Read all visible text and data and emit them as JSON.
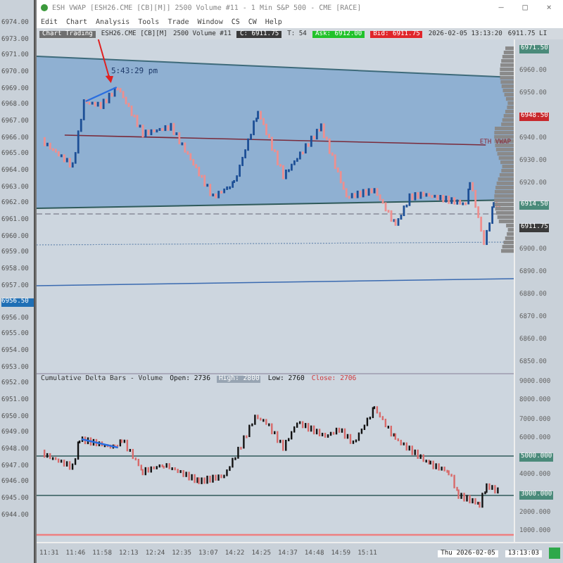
{
  "side_scale": [
    {
      "text": "6974.00",
      "kind": "tick"
    },
    {
      "text": "6973.00",
      "kind": "tick"
    },
    {
      "text": "6971.00",
      "kind": "tick"
    },
    {
      "text": "6970.00",
      "kind": "tick"
    },
    {
      "text": "6969.00",
      "kind": "tick"
    },
    {
      "text": "6968.00",
      "kind": "tick"
    },
    {
      "text": "6967.00",
      "kind": "tick"
    },
    {
      "text": "6966.00",
      "kind": "tick"
    },
    {
      "text": "6965.00",
      "kind": "tick"
    },
    {
      "text": "6964.00",
      "kind": "tick"
    },
    {
      "text": "6963.00",
      "kind": "tick"
    },
    {
      "text": "6962.00",
      "kind": "tick"
    },
    {
      "text": "6961.00",
      "kind": "tick"
    },
    {
      "text": "6960.00",
      "kind": "tick"
    },
    {
      "text": "6959.00",
      "kind": "tick"
    },
    {
      "text": "6958.00",
      "kind": "tick"
    },
    {
      "text": "6957.00",
      "kind": "tick"
    },
    {
      "text": "6956.50",
      "kind": "marker"
    },
    {
      "text": "6956.00",
      "kind": "tick"
    },
    {
      "text": "6955.00",
      "kind": "tick"
    },
    {
      "text": "6954.00",
      "kind": "tick"
    },
    {
      "text": "6953.00",
      "kind": "tick"
    },
    {
      "text": "6952.00",
      "kind": "tick"
    },
    {
      "text": "6951.00",
      "kind": "tick"
    },
    {
      "text": "6950.00",
      "kind": "tick"
    },
    {
      "text": "6949.00",
      "kind": "tick"
    },
    {
      "text": "6948.00",
      "kind": "tick"
    },
    {
      "text": "6947.00",
      "kind": "tick"
    },
    {
      "text": "6946.00",
      "kind": "tick"
    },
    {
      "text": "6945.00",
      "kind": "tick"
    },
    {
      "text": "6944.00",
      "kind": "tick"
    }
  ],
  "window": {
    "title": "ESH VWAP [ESH26.CME [CB][M]] 2500 Volume #11 - 1 Min S&P 500 - CME [RACE]",
    "controls": [
      "–",
      "□",
      "×"
    ]
  },
  "menu": [
    "Edit",
    "Chart",
    "Analysis",
    "Tools",
    "Trade",
    "Window",
    "CS",
    "CW",
    "Help"
  ],
  "info_bar": [
    {
      "text": "Chart Trading",
      "kind": "box",
      "color": "#6f6f6f"
    },
    {
      "text": "ESH26.CME [CB][M]",
      "kind": "plain"
    },
    {
      "text": "2500 Volume #11",
      "kind": "plain"
    },
    {
      "text": "C: 6911.75",
      "kind": "box",
      "color": "#3a3a3a"
    },
    {
      "text": "T: 54",
      "kind": "plain"
    },
    {
      "text": "Ask: 6912.00",
      "kind": "box",
      "color": "#22c22a"
    },
    {
      "text": "Bid: 6911.75",
      "kind": "box",
      "color": "#e0262a"
    },
    {
      "text": "2026-02-05 13:13:20",
      "kind": "plain"
    },
    {
      "text": "6911.75 LI",
      "kind": "plain"
    }
  ],
  "price_pane": {
    "annotation": "5:43:29 pm",
    "vwap_label": "ETH VWAP"
  },
  "price_axis": [
    {
      "text": "6971.50",
      "kind": "tag",
      "color": "#4a8a7a"
    },
    {
      "text": "6960.00",
      "kind": "tick"
    },
    {
      "text": "6950.00",
      "kind": "tick"
    },
    {
      "text": "6948.50",
      "kind": "tag",
      "color": "#c8282c"
    },
    {
      "text": "6940.00",
      "kind": "tick"
    },
    {
      "text": "6930.00",
      "kind": "tick"
    },
    {
      "text": "6920.00",
      "kind": "tick"
    },
    {
      "text": "6914.50",
      "kind": "tag",
      "color": "#4a8a7a"
    },
    {
      "text": "6911.75",
      "kind": "tag",
      "color": "#3a3a3a"
    },
    {
      "text": "6900.00",
      "kind": "tick"
    },
    {
      "text": "6890.00",
      "kind": "tick"
    },
    {
      "text": "6880.00",
      "kind": "tick"
    },
    {
      "text": "6870.00",
      "kind": "tick"
    },
    {
      "text": "6860.00",
      "kind": "tick"
    },
    {
      "text": "6850.00",
      "kind": "tick"
    }
  ],
  "delta_pane": {
    "header": [
      {
        "text": "Cumulative Delta Bars - Volume",
        "kind": "title"
      },
      {
        "text": "Open: 2736",
        "kind": "value"
      },
      {
        "text": "High: 2800",
        "kind": "light"
      },
      {
        "text": "Low: 2760",
        "kind": "value"
      },
      {
        "text": "Close: 2706",
        "kind": "alert"
      }
    ]
  },
  "delta_axis": [
    {
      "text": "9000.000",
      "kind": "tick"
    },
    {
      "text": "8000.000",
      "kind": "tick"
    },
    {
      "text": "7000.000",
      "kind": "tick"
    },
    {
      "text": "6000.000",
      "kind": "tick"
    },
    {
      "text": "5000.000",
      "kind": "tag",
      "color": "#4a8a7a"
    },
    {
      "text": "4000.000",
      "kind": "tick"
    },
    {
      "text": "3000.000",
      "kind": "tag",
      "color": "#4a8a7a"
    },
    {
      "text": "2000.000",
      "kind": "tick"
    },
    {
      "text": "1000.000",
      "kind": "tick"
    }
  ],
  "time_axis": {
    "times": [
      "11:31",
      "11:46",
      "11:58",
      "12:13",
      "12:24",
      "12:35",
      "13:07",
      "14:22",
      "14:25",
      "14:37",
      "14:48",
      "14:59",
      "15:11"
    ],
    "date": "Thu 2026-02-05",
    "clock": "13:13:03"
  }
}
